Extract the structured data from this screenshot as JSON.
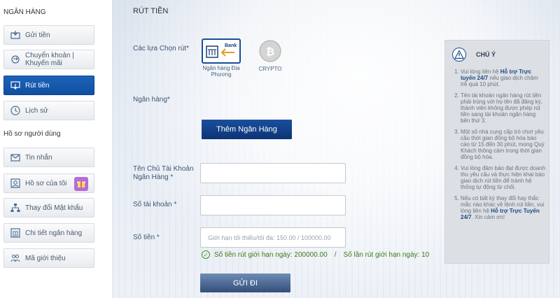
{
  "sidebar": {
    "section_bank": "NGÂN HÀNG",
    "section_profile": "Hồ sơ người dùng",
    "items": [
      {
        "label": "Gửi tiền"
      },
      {
        "label": "Chuyển khoản | Khuyến mãi"
      },
      {
        "label": "Rút tiền",
        "active": true
      },
      {
        "label": "Lịch sử"
      },
      {
        "label": "Tin nhắn"
      },
      {
        "label": "Hồ sơ của tôi"
      },
      {
        "label": "Thay đổi Mật khẩu"
      },
      {
        "label": "Chi tiết ngân hàng"
      },
      {
        "label": "Mã giới thiệu"
      }
    ]
  },
  "main": {
    "title": "RÚT TIỀN",
    "options_label": "Các lựa Chọn rút*",
    "bank_option_caption": "Ngân hàng Địa Phương",
    "bank_option_badge": "Bank",
    "crypto_option_caption": "CRYPTO",
    "bank_label": "Ngân hàng*",
    "add_bank_button": "Thêm Ngân Hàng",
    "account_name_label": "Tên Chủ Tài Khoản Ngân Hàng *",
    "account_name_value": "",
    "account_number_label": "Số tài khoản *",
    "account_number_value": "",
    "amount_label": "Số tiền *",
    "amount_placeholder": "Giới hạn tối thiểu/tối đa: 150.00 / 100000.00",
    "daily_amount_limit": "Số tiền rút giới hạn ngày: 200000.00",
    "limit_separator": "/",
    "daily_count_limit": "Số lần rút giới hạn ngày: 10",
    "submit_button": "GỬI ĐI"
  },
  "notice": {
    "title": "CHÚ Ý",
    "items": [
      {
        "before": "Vui lòng liên hệ ",
        "highlight": "Hỗ trợ Trực tuyến 24/7",
        "after": " nếu giao dịch chậm trễ quá 10 phút."
      },
      {
        "before": "Tên tài khoản ngân hàng rút tiền phải trùng với họ tên đã đăng ký, thành viên không được phép rút tiền sang tài khoản ngân hàng bên thứ 3.",
        "highlight": "",
        "after": ""
      },
      {
        "before": "Một số nhà cung cấp trò chơi yêu cầu thời gian đồng bộ hóa báo cáo từ 15 đến 30 phút, mong Quý Khách thông cảm trong thời gian đồng bộ hóa.",
        "highlight": "",
        "after": ""
      },
      {
        "before": "Vui lòng đảm bảo đạt được doanh thu yêu cầu và thực hiện khai báo giao dịch rút tiền để tránh hệ thống tự động từ chối.",
        "highlight": "",
        "after": ""
      },
      {
        "before": "Nếu có bất kỳ thay đổi hay thắc mắc nào khác về lệnh rút tiền, vui lòng liên hệ ",
        "highlight": "Hỗ trợ Trực Tuyến 24/7",
        "after": ". Xin cám ơn!"
      }
    ]
  },
  "colors": {
    "primary": "#0f4fa0",
    "success": "#3c7a1a",
    "highlight": "#1d4b85"
  }
}
